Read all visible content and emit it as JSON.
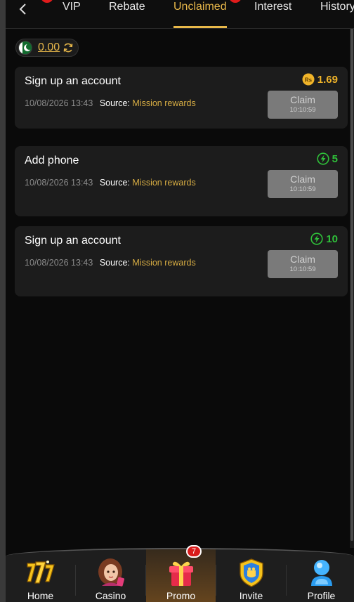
{
  "tabs": [
    {
      "label": "VIP"
    },
    {
      "label": "Rebate"
    },
    {
      "label": "Unclaimed",
      "active": true
    },
    {
      "label": "Interest"
    },
    {
      "label": "History"
    }
  ],
  "balance": {
    "value": "0.00",
    "currency_flag": "pakistan-flag-icon"
  },
  "rewards": [
    {
      "title": "Sign up an account",
      "date": "10/08/2026 13:43",
      "source_label": "Source:",
      "source": "Mission rewards",
      "reward_type": "coin",
      "coin_symbol": "Rs",
      "amount": "1.69",
      "claim_label": "Claim",
      "countdown": "10:10:59"
    },
    {
      "title": "Add phone",
      "date": "10/08/2026 13:43",
      "source_label": "Source:",
      "source": "Mission rewards",
      "reward_type": "energy",
      "amount": "5",
      "claim_label": "Claim",
      "countdown": "10:10:59"
    },
    {
      "title": "Sign up an account",
      "date": "10/08/2026 13:43",
      "source_label": "Source:",
      "source": "Mission rewards",
      "reward_type": "energy",
      "amount": "10",
      "claim_label": "Claim",
      "countdown": "10:10:59"
    }
  ],
  "nav": [
    {
      "label": "Home",
      "icon": "lucky-seven-icon"
    },
    {
      "label": "Casino",
      "icon": "casino-girl-icon"
    },
    {
      "label": "Promo",
      "icon": "gift-box-icon",
      "active": true,
      "badge": "7"
    },
    {
      "label": "Invite",
      "icon": "invite-shield-icon"
    },
    {
      "label": "Profile",
      "icon": "profile-avatar-icon"
    }
  ],
  "colors": {
    "accent": "#e8b84a",
    "card": "#1c1c1c",
    "energy": "#2fc23a",
    "coin": "#f0b429",
    "badge": "#d91c1c"
  }
}
